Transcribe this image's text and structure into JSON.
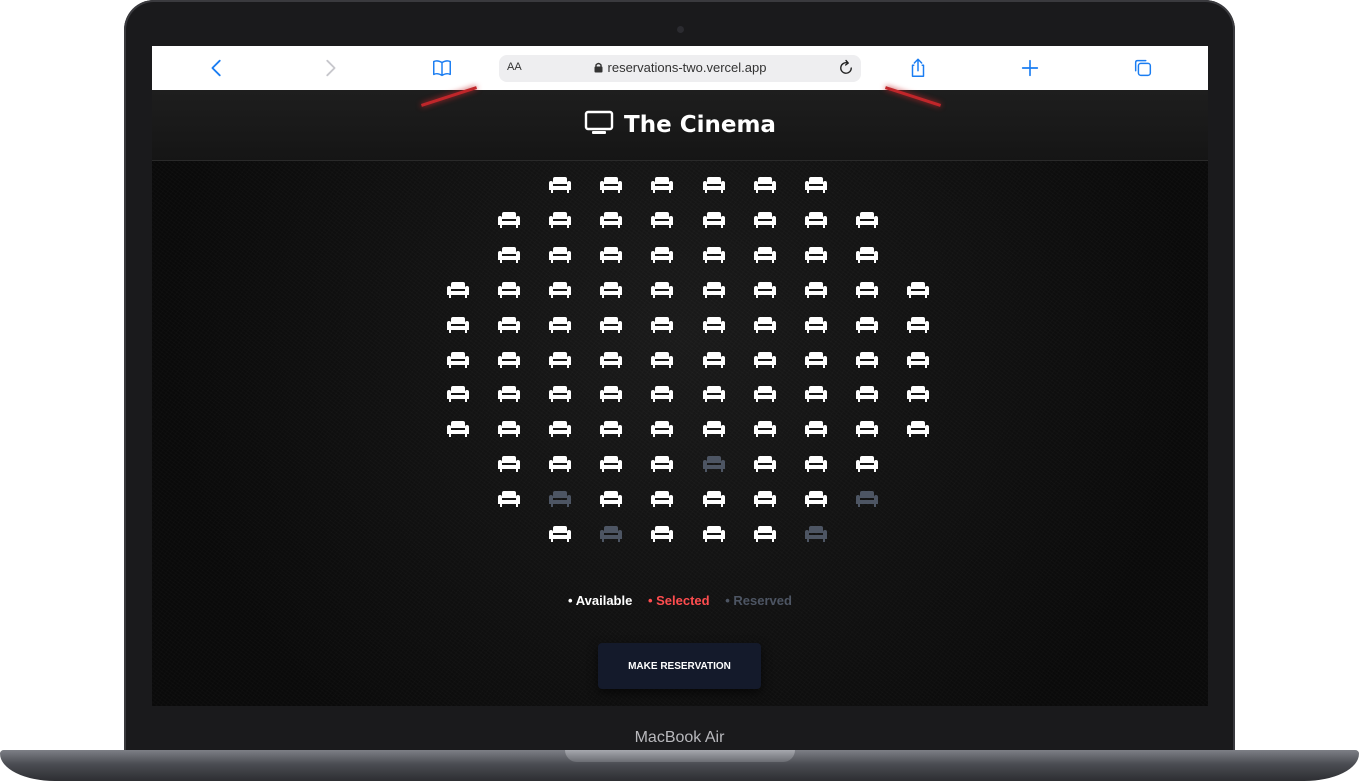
{
  "browser": {
    "text_size_label": "AA",
    "url": "reservations-two.vercel.app"
  },
  "app": {
    "title": "The Cinema"
  },
  "seating": {
    "rows": [
      [
        "available",
        "available",
        "available",
        "available",
        "available",
        "available"
      ],
      [
        "available",
        "available",
        "available",
        "available",
        "available",
        "available",
        "available",
        "available"
      ],
      [
        "available",
        "available",
        "available",
        "available",
        "available",
        "available",
        "available",
        "available"
      ],
      [
        "available",
        "available",
        "available",
        "available",
        "available",
        "available",
        "available",
        "available",
        "available",
        "available"
      ],
      [
        "available",
        "available",
        "available",
        "available",
        "available",
        "available",
        "available",
        "available",
        "available",
        "available"
      ],
      [
        "available",
        "available",
        "available",
        "available",
        "available",
        "available",
        "available",
        "available",
        "available",
        "available"
      ],
      [
        "available",
        "available",
        "available",
        "available",
        "available",
        "available",
        "available",
        "available",
        "available",
        "available"
      ],
      [
        "available",
        "available",
        "available",
        "available",
        "available",
        "available",
        "available",
        "available",
        "available",
        "available"
      ],
      [
        "available",
        "available",
        "available",
        "available",
        "reserved",
        "available",
        "available",
        "available"
      ],
      [
        "available",
        "reserved",
        "available",
        "available",
        "available",
        "available",
        "available",
        "reserved"
      ],
      [
        "available",
        "reserved",
        "available",
        "available",
        "available",
        "reserved"
      ]
    ],
    "colors": {
      "available": "#ffffff",
      "selected": "#ff4d4f",
      "reserved": "#4d5563"
    }
  },
  "legend": {
    "available": "• Available",
    "selected": "• Selected",
    "reserved": "• Reserved"
  },
  "actions": {
    "make_reservation": "MAKE RESERVATION"
  },
  "device": {
    "label": "MacBook Air"
  }
}
